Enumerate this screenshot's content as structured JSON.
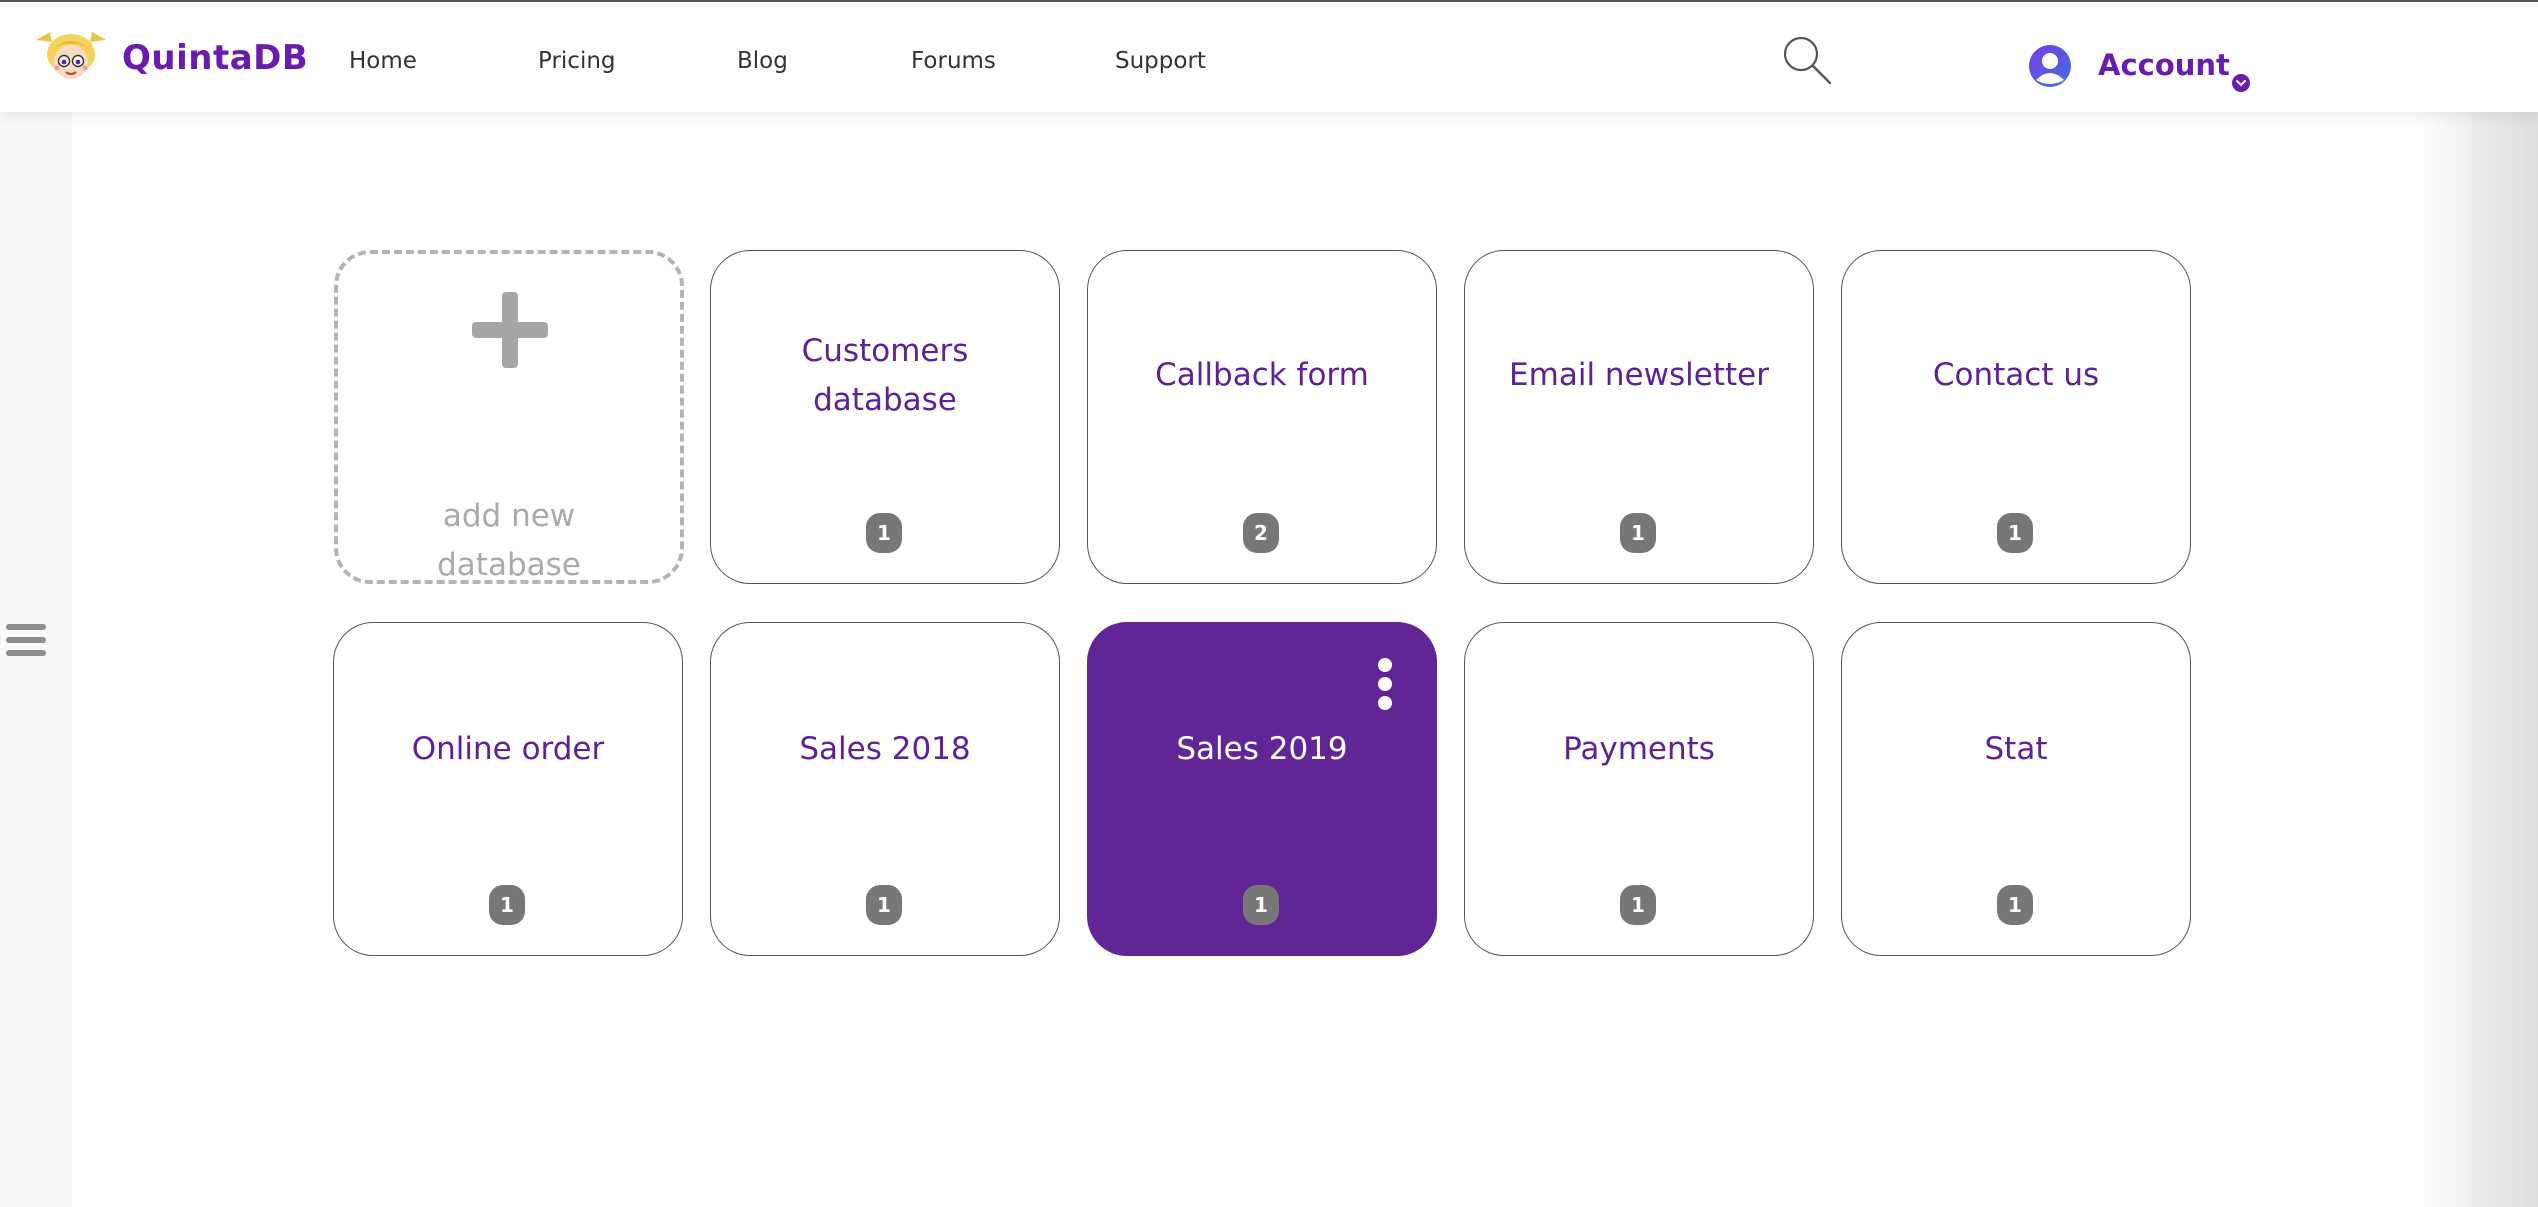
{
  "header": {
    "brand": "QuintaDB",
    "nav": [
      "Home",
      "Pricing",
      "Blog",
      "Forums",
      "Support"
    ],
    "account_label": "Account",
    "icons": {
      "logo": "cartoon-girl-logo",
      "search": "search-icon",
      "avatar": "user-avatar-icon",
      "account_menu": "chevron-down-icon"
    }
  },
  "sidebar": {
    "menu_icon": "hamburger-menu-icon"
  },
  "add_tile": {
    "icon": "plus-icon",
    "label_line1": "add new",
    "label_line2": "database"
  },
  "tiles": [
    {
      "title_line1": "Customers",
      "title_line2": "database",
      "badge": "1"
    },
    {
      "title_line1": "Callback form",
      "title_line2": "",
      "badge": "2"
    },
    {
      "title_line1": "Email newsletter",
      "title_line2": "",
      "badge": "1"
    },
    {
      "title_line1": "Contact us",
      "title_line2": "",
      "badge": "1"
    },
    {
      "title_line1": "Online order",
      "title_line2": "",
      "badge": "1"
    },
    {
      "title_line1": "Sales 2018",
      "title_line2": "",
      "badge": "1"
    },
    {
      "title_line1": "Sales 2019",
      "title_line2": "",
      "badge": "1",
      "selected": true,
      "menu_icon": "kebab-menu-icon"
    },
    {
      "title_line1": "Payments",
      "title_line2": "",
      "badge": "1"
    },
    {
      "title_line1": "Stat",
      "title_line2": "",
      "badge": "1"
    }
  ],
  "colors": {
    "brand": "#6a1bb0",
    "tile_title": "#5e2196",
    "selected_tile": "#612596",
    "badge": "#777777",
    "add_dashed": "#b4b4b4"
  }
}
